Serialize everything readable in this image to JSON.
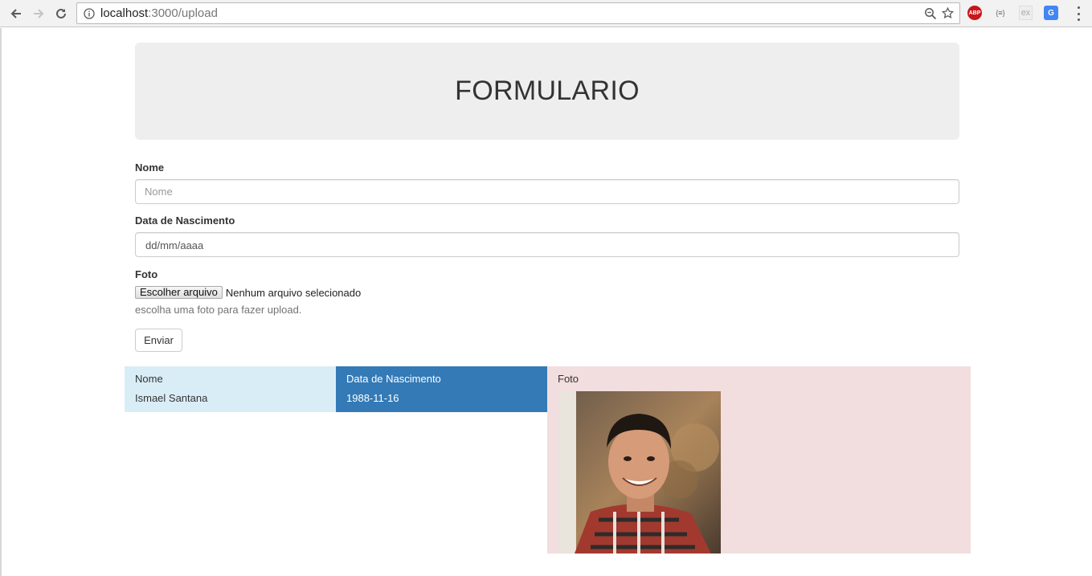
{
  "browser": {
    "url_host": "localhost",
    "url_path": ":3000/upload",
    "extensions": {
      "abp": "ABP",
      "json": "{≡}",
      "ex": "ex",
      "translate": "G"
    }
  },
  "header": {
    "title": "FORMULARIO"
  },
  "form": {
    "nome_label": "Nome",
    "nome_placeholder": "Nome",
    "data_label": "Data de Nascimento",
    "data_value": "dd/mm/aaaa",
    "foto_label": "Foto",
    "file_button": "Escolher arquivo",
    "file_status": "Nenhum arquivo selecionado",
    "help_text": "escolha uma foto para fazer upload.",
    "submit_label": "Enviar"
  },
  "results": {
    "columns": [
      "Nome",
      "Data de Nascimento",
      "Foto"
    ],
    "row": {
      "nome": "Ismael Santana",
      "data": "1988-11-16"
    }
  },
  "colors": {
    "info_bg": "#d9edf7",
    "primary_bg": "#337ab7",
    "danger_bg": "#f2dede",
    "jumbotron_bg": "#eeeeee"
  }
}
